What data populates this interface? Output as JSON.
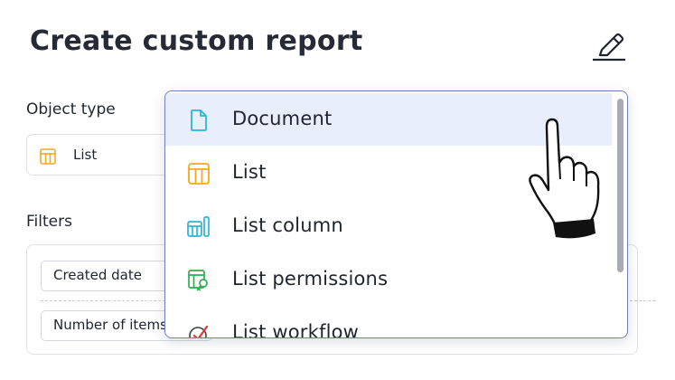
{
  "header": {
    "title": "Create custom report"
  },
  "object_type": {
    "label": "Object type",
    "selected": "List"
  },
  "filters": {
    "label": "Filters",
    "chips": [
      "Created date",
      "Number of items"
    ]
  },
  "dropdown": {
    "options": [
      {
        "label": "Document",
        "icon": "document-icon",
        "color": "#29b6d6",
        "highlighted": true
      },
      {
        "label": "List",
        "icon": "list-icon",
        "color": "#f5a623"
      },
      {
        "label": "List column",
        "icon": "list-column-icon",
        "color": "#29b6d6"
      },
      {
        "label": "List permissions",
        "icon": "list-permissions-icon",
        "color": "#2eae4f"
      },
      {
        "label": "List workflow",
        "icon": "list-workflow-icon",
        "color": "#e53935"
      }
    ]
  },
  "colors": {
    "accent_border": "#6f7fc4",
    "highlight": "#e8eefb"
  }
}
